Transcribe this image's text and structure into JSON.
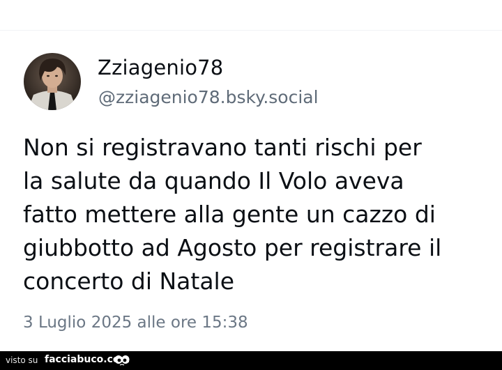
{
  "post": {
    "author": {
      "display_name": "Zziagenio78",
      "handle": "@zziagenio78.bsky.social",
      "avatar_icon": "user-avatar-photo"
    },
    "text_lines": [
      "Non si registravano tanti rischi per",
      "la salute da quando Il Volo aveva",
      "fatto mettere alla gente un cazzo di",
      "giubbotto ad Agosto per registrare il",
      "concerto di Natale"
    ],
    "timestamp": "3 Luglio 2025 alle ore 15:38"
  },
  "watermark": {
    "prefix": "visto su",
    "site": "facciabuco.com",
    "logo_icon": "eyes-icon"
  },
  "colors": {
    "text_primary": "#0b0f14",
    "text_secondary": "#5f6b78",
    "background": "#ffffff",
    "watermark_bar": "#000000"
  }
}
